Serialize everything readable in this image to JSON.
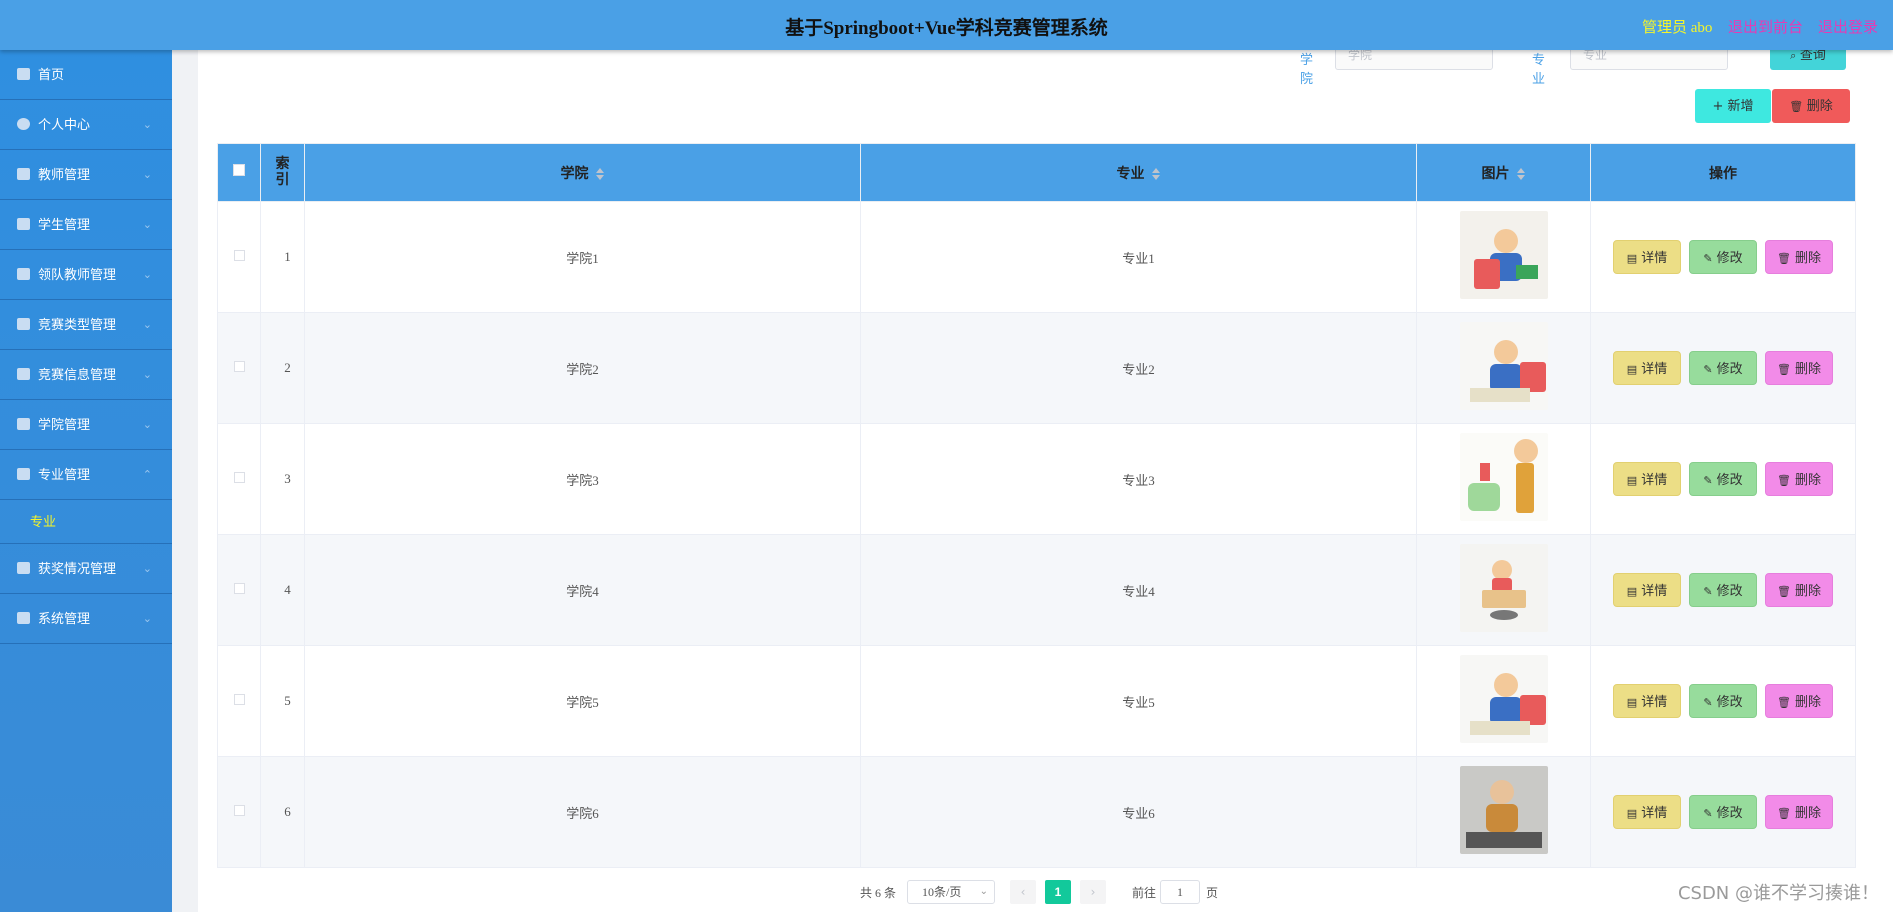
{
  "header": {
    "title": "基于Springboot+Vue学科竞赛管理系统",
    "admin": "管理员 abo",
    "front": "退出到前台",
    "logout": "退出登录"
  },
  "sidebar": {
    "items": [
      {
        "label": "首页",
        "icon": "home-icon",
        "chevron": false
      },
      {
        "label": "个人中心",
        "icon": "user-icon",
        "chevron": true
      },
      {
        "label": "教师管理",
        "icon": "monitor-icon",
        "chevron": true
      },
      {
        "label": "学生管理",
        "icon": "library-icon",
        "chevron": true
      },
      {
        "label": "领队教师管理",
        "icon": "ticket-icon",
        "chevron": true
      },
      {
        "label": "竞赛类型管理",
        "icon": "trophy-icon",
        "chevron": true
      },
      {
        "label": "竞赛信息管理",
        "icon": "chat-icon",
        "chevron": true
      },
      {
        "label": "学院管理",
        "icon": "comment-icon",
        "chevron": true
      },
      {
        "label": "专业管理",
        "icon": "flag-icon",
        "chevron": true,
        "expanded": true
      }
    ],
    "submenu": "专业",
    "items_after": [
      {
        "label": "获奖情况管理",
        "icon": "suitcase-icon",
        "chevron": true
      },
      {
        "label": "系统管理",
        "icon": "check-square-icon",
        "chevron": true
      }
    ]
  },
  "search": {
    "college_label": "学院",
    "college_placeholder": "学院",
    "major_label": "专业",
    "major_placeholder": "专业",
    "query_button": "查询"
  },
  "toolbar": {
    "add": "新增",
    "delete": "删除"
  },
  "table": {
    "columns": [
      "索引",
      "学院",
      "专业",
      "图片",
      "操作"
    ],
    "rows": [
      {
        "index": "1",
        "college": "学院1",
        "major": "专业1"
      },
      {
        "index": "2",
        "college": "学院2",
        "major": "专业2"
      },
      {
        "index": "3",
        "college": "学院3",
        "major": "专业3"
      },
      {
        "index": "4",
        "college": "学院4",
        "major": "专业4"
      },
      {
        "index": "5",
        "college": "学院5",
        "major": "专业5"
      },
      {
        "index": "6",
        "college": "学院6",
        "major": "专业6"
      }
    ],
    "ops": {
      "detail": "详情",
      "edit": "修改",
      "delete": "删除"
    }
  },
  "pagination": {
    "total": "共 6 条",
    "page_size": "10条/页",
    "current": "1",
    "goto_label": "前往",
    "goto_value": "1",
    "goto_suffix": "页"
  },
  "watermark": "CSDN @谁不学习揍谁！",
  "colors": {
    "header": "#4aa0e6",
    "sidebar": "#2f8fe0",
    "accent_yellow": "#f5f52a",
    "accent_pink": "#e63bb5",
    "pager_active": "#12c99b"
  }
}
